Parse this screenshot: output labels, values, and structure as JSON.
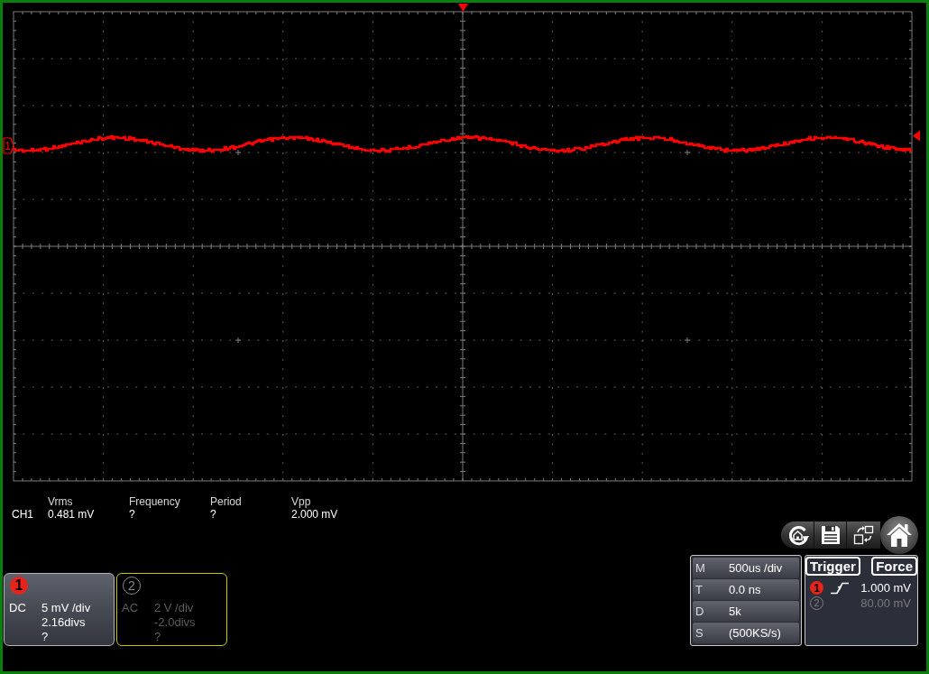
{
  "scope": {
    "channel_marker": {
      "label": "1"
    }
  },
  "measurements": {
    "channel": "CH1",
    "items": [
      {
        "label": "Vrms",
        "value": "0.481 mV"
      },
      {
        "label": "Frequency",
        "value": "?"
      },
      {
        "label": "Period",
        "value": "?"
      },
      {
        "label": "Vpp",
        "value": "2.000 mV"
      }
    ]
  },
  "channels": [
    {
      "number": "1",
      "enabled": true,
      "color": "#e8231c",
      "coupling": "DC",
      "scale": "5 mV /div",
      "offset": "2.16divs",
      "reading": "?"
    },
    {
      "number": "2",
      "enabled": false,
      "color": "#c8c800",
      "coupling": "AC",
      "scale": "2 V /div",
      "offset": "-2.0divs",
      "reading": "?"
    }
  ],
  "timebase": [
    {
      "key": "M",
      "value": "500us /div"
    },
    {
      "key": "T",
      "value": "0.0 ns"
    },
    {
      "key": "D",
      "value": "5k"
    },
    {
      "key": "S",
      "value": "(500KS/s)"
    }
  ],
  "trigger": {
    "buttons": [
      "Trigger",
      "Force"
    ],
    "sources": [
      {
        "channel": "1",
        "level": "1.000 mV",
        "selected": true
      },
      {
        "channel": "2",
        "level": "80.00 mV",
        "selected": false
      }
    ]
  }
}
